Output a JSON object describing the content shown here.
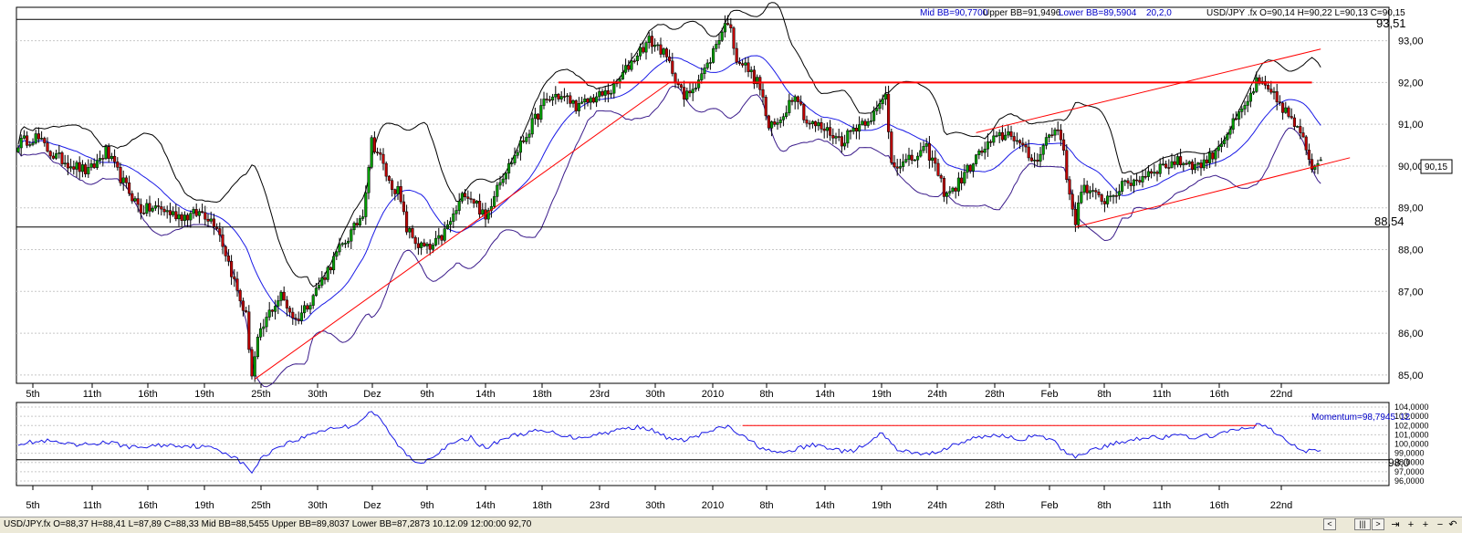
{
  "price_panel": {
    "legend": {
      "mid": "Mid BB=90,7700",
      "upper": "Upper BB=91,9496",
      "lower": "Lower BB=89,5904",
      "params": "20,2,0",
      "ohlc": "USD/JPY .fx O=90,14 H=90,22 L=90,13 C=90,15"
    },
    "hline_labels": [
      "93,51",
      "88,54"
    ],
    "current_price_label": "90,15",
    "current_price_label_hidden": "90,00"
  },
  "momentum_panel": {
    "legend": "Momentum=98,7945",
    "legend_period": "12",
    "value_label": "98,0"
  },
  "x_tick_labels": [
    "5th",
    "11th",
    "16th",
    "19th",
    "25th",
    "30th",
    "Dez",
    "9th",
    "14th",
    "18th",
    "23rd",
    "30th",
    "2010",
    "8th",
    "14th",
    "19th",
    "24th",
    "28th",
    "Feb",
    "8th",
    "11th",
    "16th",
    "22nd"
  ],
  "status_bar": {
    "text": "USD/JPY.fx O=88,37 H=88,41 L=87,89 C=88,33  Mid BB=88,5455 Upper BB=89,8037 Lower BB=87,2873  10.12.09 12:00:00 92,70"
  },
  "nav_buttons": [
    {
      "icon": "scroll-left-icon",
      "glyph": "<"
    },
    {
      "icon": "scrollbar-thumb-icon",
      "glyph": "|||"
    },
    {
      "icon": "scroll-right-icon",
      "glyph": ">"
    },
    {
      "icon": "scroll-end-icon",
      "glyph": "⇥"
    },
    {
      "icon": "zoom-in-icon",
      "glyph": "+"
    },
    {
      "icon": "crosshair-icon",
      "glyph": "+"
    },
    {
      "icon": "zoom-out-icon",
      "glyph": "−"
    },
    {
      "icon": "reset-icon",
      "glyph": "↶"
    }
  ],
  "colors": {
    "bull": "#00a000",
    "bear": "#c00000",
    "bb_outer": "#000000",
    "bb_mid": "#1a1ae6",
    "momentum": "#1a1ae6",
    "trend_line": "#ff0000",
    "resistance": "#ff0000",
    "grid": "#c8c8c8",
    "legend_blue": "#0000c8"
  },
  "chart_data": [
    {
      "type": "candlestick",
      "symbol": "USD/JPY .fx",
      "x_labels": [
        "5th",
        "11th",
        "16th",
        "19th",
        "25th",
        "30th",
        "Dez",
        "9th",
        "14th",
        "18th",
        "23rd",
        "30th",
        "2010",
        "8th",
        "14th",
        "19th",
        "24th",
        "28th",
        "Feb",
        "8th",
        "11th",
        "16th",
        "22nd"
      ],
      "ylim": [
        84.8,
        93.8
      ],
      "y_tick_labels": [
        "85,00",
        "86,00",
        "87,00",
        "88,00",
        "89,00",
        "90,00",
        "91,00",
        "92,00",
        "93,00"
      ],
      "grid": true,
      "bollinger": {
        "period": 20,
        "deviations": 2,
        "shift": 0,
        "mid": 90.77,
        "upper": 91.9496,
        "lower": 89.5904
      },
      "horizontal_lines": [
        93.51,
        88.54
      ],
      "resistance_line": 92.0,
      "last": {
        "open": 90.14,
        "high": 90.22,
        "low": 90.13,
        "close": 90.15
      },
      "path": [
        [
          0,
          90.55
        ],
        [
          6,
          90.7
        ],
        [
          12,
          90.25
        ],
        [
          18,
          90.05
        ],
        [
          24,
          89.85
        ],
        [
          30,
          90.35
        ],
        [
          36,
          89.6
        ],
        [
          42,
          88.95
        ],
        [
          48,
          89.0
        ],
        [
          53,
          88.85
        ],
        [
          58,
          88.8
        ],
        [
          63,
          88.9
        ],
        [
          68,
          88.6
        ],
        [
          72,
          87.7
        ],
        [
          75,
          87.0
        ],
        [
          78,
          86.4
        ],
        [
          80,
          85.0
        ],
        [
          82,
          85.8
        ],
        [
          86,
          86.5
        ],
        [
          90,
          86.9
        ],
        [
          95,
          86.3
        ],
        [
          100,
          86.8
        ],
        [
          105,
          87.4
        ],
        [
          110,
          88.0
        ],
        [
          115,
          88.5
        ],
        [
          118,
          88.9
        ],
        [
          121,
          90.6
        ],
        [
          124,
          90.2
        ],
        [
          127,
          89.6
        ],
        [
          130,
          89.4
        ],
        [
          133,
          88.5
        ],
        [
          137,
          88.1
        ],
        [
          141,
          88.0
        ],
        [
          145,
          88.3
        ],
        [
          149,
          88.8
        ],
        [
          153,
          89.4
        ],
        [
          157,
          89.1
        ],
        [
          160,
          88.7
        ],
        [
          164,
          89.6
        ],
        [
          168,
          90.0
        ],
        [
          172,
          90.5
        ],
        [
          176,
          91.0
        ],
        [
          180,
          91.5
        ],
        [
          184,
          91.7
        ],
        [
          188,
          91.6
        ],
        [
          192,
          91.4
        ],
        [
          196,
          91.6
        ],
        [
          200,
          91.7
        ],
        [
          204,
          91.85
        ],
        [
          208,
          92.3
        ],
        [
          212,
          92.7
        ],
        [
          216,
          93.0
        ],
        [
          220,
          92.8
        ],
        [
          224,
          92.3
        ],
        [
          228,
          91.6
        ],
        [
          232,
          92.0
        ],
        [
          236,
          92.4
        ],
        [
          240,
          93.1
        ],
        [
          243,
          93.5
        ],
        [
          246,
          92.6
        ],
        [
          250,
          92.3
        ],
        [
          254,
          91.9
        ],
        [
          257,
          90.9
        ],
        [
          260,
          91.0
        ],
        [
          263,
          91.4
        ],
        [
          266,
          91.8
        ],
        [
          270,
          91.05
        ],
        [
          274,
          90.95
        ],
        [
          278,
          90.8
        ],
        [
          282,
          90.6
        ],
        [
          286,
          90.9
        ],
        [
          290,
          91.1
        ],
        [
          294,
          91.3
        ],
        [
          297,
          91.7
        ],
        [
          299,
          90.1
        ],
        [
          303,
          90.05
        ],
        [
          307,
          90.2
        ],
        [
          311,
          90.4
        ],
        [
          314,
          90.0
        ],
        [
          317,
          89.4
        ],
        [
          320,
          89.4
        ],
        [
          324,
          89.8
        ],
        [
          328,
          90.2
        ],
        [
          332,
          90.5
        ],
        [
          336,
          90.7
        ],
        [
          340,
          90.8
        ],
        [
          344,
          90.4
        ],
        [
          348,
          90.1
        ],
        [
          352,
          90.65
        ],
        [
          356,
          90.9
        ],
        [
          358,
          90.4
        ],
        [
          360,
          89.2
        ],
        [
          362,
          88.7
        ],
        [
          364,
          89.5
        ],
        [
          368,
          89.3
        ],
        [
          372,
          89.2
        ],
        [
          376,
          89.4
        ],
        [
          380,
          89.6
        ],
        [
          384,
          89.7
        ],
        [
          388,
          89.9
        ],
        [
          392,
          90.0
        ],
        [
          396,
          90.1
        ],
        [
          400,
          90.1
        ],
        [
          404,
          90.0
        ],
        [
          408,
          90.2
        ],
        [
          412,
          90.6
        ],
        [
          416,
          91.0
        ],
        [
          420,
          91.4
        ],
        [
          424,
          92.0
        ],
        [
          428,
          91.8
        ],
        [
          432,
          91.5
        ],
        [
          436,
          91.1
        ],
        [
          440,
          90.6
        ],
        [
          443,
          90.0
        ],
        [
          446,
          90.15
        ]
      ]
    },
    {
      "type": "line",
      "name": "Momentum",
      "period": 12,
      "value": 98.7945,
      "x_labels": [
        "5th",
        "11th",
        "16th",
        "19th",
        "25th",
        "30th",
        "Dez",
        "9th",
        "14th",
        "18th",
        "23rd",
        "30th",
        "2010",
        "8th",
        "14th",
        "19th",
        "24th",
        "28th",
        "Feb",
        "8th",
        "11th",
        "16th",
        "22nd"
      ],
      "ylim": [
        95.5,
        104.5
      ],
      "y_tick_labels": [
        "104,0000",
        "103,0000",
        "102,0000",
        "101,0000",
        "100,0000",
        "99,0000",
        "98,0000",
        "97,0000",
        "96,0000"
      ],
      "reference_line": 102.0,
      "path": [
        [
          0,
          100.1
        ],
        [
          10,
          100.3
        ],
        [
          20,
          99.8
        ],
        [
          30,
          100.2
        ],
        [
          40,
          99.6
        ],
        [
          50,
          99.9
        ],
        [
          60,
          99.8
        ],
        [
          68,
          99.5
        ],
        [
          74,
          98.6
        ],
        [
          80,
          97.0
        ],
        [
          84,
          98.7
        ],
        [
          90,
          99.9
        ],
        [
          96,
          100.5
        ],
        [
          102,
          101.3
        ],
        [
          108,
          101.8
        ],
        [
          114,
          101.9
        ],
        [
          118,
          102.8
        ],
        [
          121,
          103.6
        ],
        [
          125,
          102.2
        ],
        [
          129,
          100.3
        ],
        [
          133,
          98.8
        ],
        [
          137,
          97.9
        ],
        [
          141,
          98.5
        ],
        [
          145,
          99.4
        ],
        [
          150,
          100.2
        ],
        [
          155,
          100.7
        ],
        [
          160,
          99.5
        ],
        [
          166,
          100.6
        ],
        [
          172,
          101.1
        ],
        [
          178,
          101.4
        ],
        [
          184,
          101.2
        ],
        [
          190,
          100.7
        ],
        [
          196,
          100.9
        ],
        [
          202,
          101.3
        ],
        [
          208,
          101.7
        ],
        [
          214,
          101.9
        ],
        [
          220,
          101.0
        ],
        [
          226,
          100.3
        ],
        [
          232,
          100.8
        ],
        [
          238,
          101.5
        ],
        [
          243,
          101.9
        ],
        [
          248,
          100.8
        ],
        [
          254,
          99.7
        ],
        [
          260,
          98.9
        ],
        [
          266,
          99.4
        ],
        [
          272,
          99.9
        ],
        [
          278,
          99.6
        ],
        [
          284,
          99.1
        ],
        [
          290,
          99.8
        ],
        [
          296,
          101.2
        ],
        [
          300,
          99.6
        ],
        [
          306,
          99.0
        ],
        [
          312,
          98.9
        ],
        [
          318,
          99.6
        ],
        [
          324,
          100.3
        ],
        [
          330,
          100.8
        ],
        [
          336,
          101.0
        ],
        [
          342,
          100.5
        ],
        [
          348,
          100.8
        ],
        [
          354,
          100.5
        ],
        [
          358,
          99.2
        ],
        [
          362,
          98.7
        ],
        [
          368,
          99.4
        ],
        [
          374,
          99.9
        ],
        [
          380,
          100.4
        ],
        [
          386,
          100.8
        ],
        [
          392,
          100.7
        ],
        [
          398,
          100.9
        ],
        [
          404,
          100.7
        ],
        [
          410,
          101.0
        ],
        [
          416,
          101.4
        ],
        [
          422,
          101.9
        ],
        [
          426,
          102.1
        ],
        [
          430,
          101.3
        ],
        [
          436,
          100.0
        ],
        [
          440,
          99.2
        ],
        [
          446,
          99.4
        ]
      ]
    }
  ]
}
